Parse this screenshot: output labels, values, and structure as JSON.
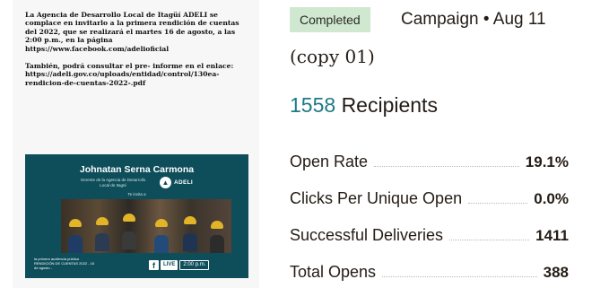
{
  "preview": {
    "paragraph_1": "La Agencia de Desarrollo Local de Itagüí ADELI se complace en invitarlo a la primera rendición de cuentas del 2022, que se realizará el martes 16 de agosto, a las 2:00 p.m., en la página https://www.facebook.com/adelioficial",
    "paragraph_2": "También, podrá consultar el pre- informe en el enlace: https://adeli.gov.co/uploads/entidad/control/130ea-rendicion-de-cuentas-2022-.pdf",
    "banner": {
      "name": "Johnatan Serna Carmona",
      "subtitle": "Gerente de la Agencia de Desarrollo Local de Itagüí",
      "logo_text": "ADELI",
      "invite": "Te invita a",
      "bottom_text": "la primera audiencia pública RENDICIÓN DE CUENTAS 2022 - 16 de agosto -",
      "live_label": "LIVE",
      "time_label": "2:00 p.m."
    }
  },
  "campaign": {
    "status": "Completed",
    "meta": "Campaign • Aug 11",
    "name": "(copy 01)",
    "recipients_count": "1558",
    "recipients_label": "Recipients"
  },
  "stats": [
    {
      "label": "Open Rate",
      "value": "19.1%"
    },
    {
      "label": "Clicks Per Unique Open",
      "value": "0.0%"
    },
    {
      "label": "Successful Deliveries",
      "value": "1411"
    },
    {
      "label": "Total Opens",
      "value": "388"
    }
  ],
  "colors": {
    "badge_bg": "#cfe8cf",
    "recipients_accent": "#1f7a86",
    "banner_bg": "#0e4d5a"
  }
}
